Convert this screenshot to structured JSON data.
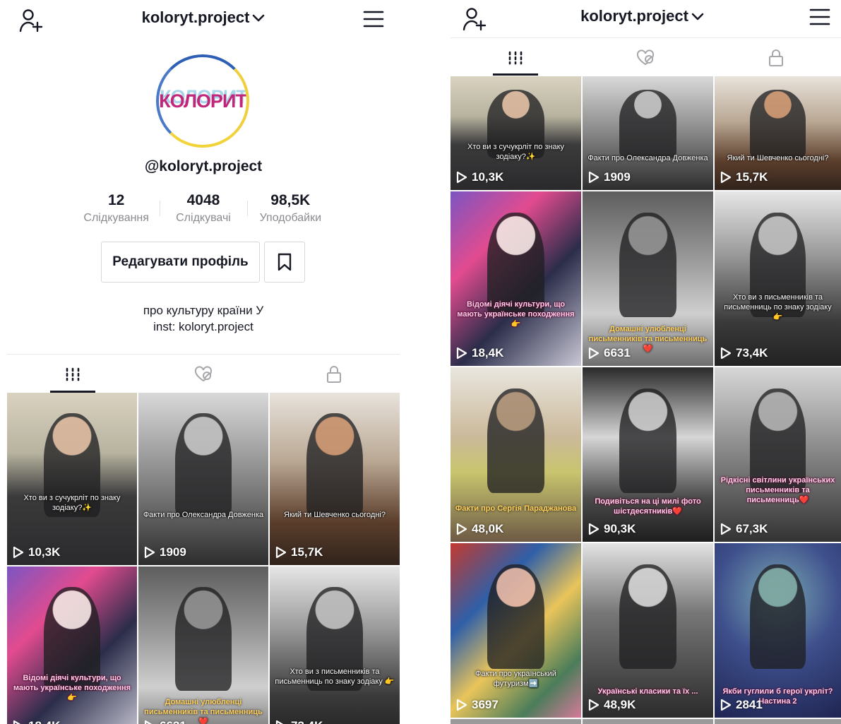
{
  "header": {
    "username": "koloryt.project"
  },
  "profile": {
    "avatar_text": "КОЛОРИТ",
    "handle": "@koloryt.project",
    "stats": [
      {
        "value": "12",
        "label": "Слідкування"
      },
      {
        "value": "4048",
        "label": "Слідкувачі"
      },
      {
        "value": "98,5K",
        "label": "Уподобайки"
      }
    ],
    "edit_label": "Редагувати профіль",
    "bio_line1": "про культуру країни У",
    "bio_line2": "inst: koloryt.project"
  },
  "tabs": [
    {
      "name": "videos",
      "icon": "grid-icon",
      "active": true
    },
    {
      "name": "liked",
      "icon": "liked-hidden-icon",
      "active": false
    },
    {
      "name": "private",
      "icon": "lock-icon",
      "active": false
    }
  ],
  "videos": [
    {
      "caption": "Хто ви з сучукрліт по знаку зодіаку?✨",
      "views": "10,3K"
    },
    {
      "caption": "Факти про Олександра Довженка",
      "views": "1909"
    },
    {
      "caption": "Який ти Шевченко сьогодні?",
      "views": "15,7K"
    },
    {
      "caption": "Відомі діячі культури, що мають українське походження 👉",
      "views": "18,4K"
    },
    {
      "caption": "Домашні улюбленці письменників та письменниць❤️",
      "views": "6631"
    },
    {
      "caption": "Хто ви з письменників та письменниць по знаку зодіаку 👉",
      "views": "73,4K"
    },
    {
      "caption": "Факти про Сергія Параджанова",
      "views": "48,0K"
    },
    {
      "caption": "Подивіться на ці милі фото шістдесятників❤️",
      "views": "90,3K"
    },
    {
      "caption": "Рідкісні світлини українських письменників та письменниць❤️",
      "views": "67,3K"
    },
    {
      "caption": "Факти про український футуризм➡️",
      "views": "3697"
    },
    {
      "caption": "Українські класики та їх ...",
      "views": "48,9K"
    },
    {
      "caption": "Якби гуглили б герої укрліт? Частина 2",
      "views": "2841"
    }
  ],
  "colors": {
    "text": "#161823",
    "muted": "#8a8b91",
    "accent_pink": "#c2267b"
  }
}
